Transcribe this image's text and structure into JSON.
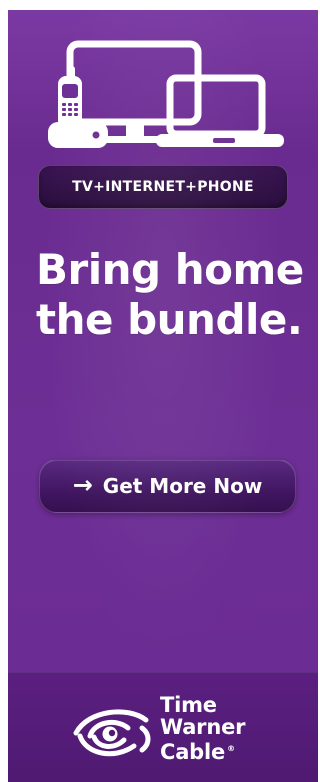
{
  "ad": {
    "pill_text": "TV+INTERNET+PHONE",
    "headline_line1": "Bring home",
    "headline_line2": "the bundle.",
    "cta": {
      "arrow": "→",
      "label": "Get More Now"
    },
    "brand": {
      "line1": "Time",
      "line2": "Warner",
      "line3": "Cable",
      "registered": "®"
    }
  },
  "icons": {
    "devices": "tv-laptop-phone-icon",
    "logo": "time-warner-cable-eye-logo-icon",
    "cta_arrow": "right-arrow-icon"
  },
  "colors": {
    "background_purple": "#6d2f95",
    "dark_pill": "#2a0e3d",
    "cta_purple": "#3f155f",
    "footer_purple": "#4f1a72",
    "white": "#ffffff"
  }
}
